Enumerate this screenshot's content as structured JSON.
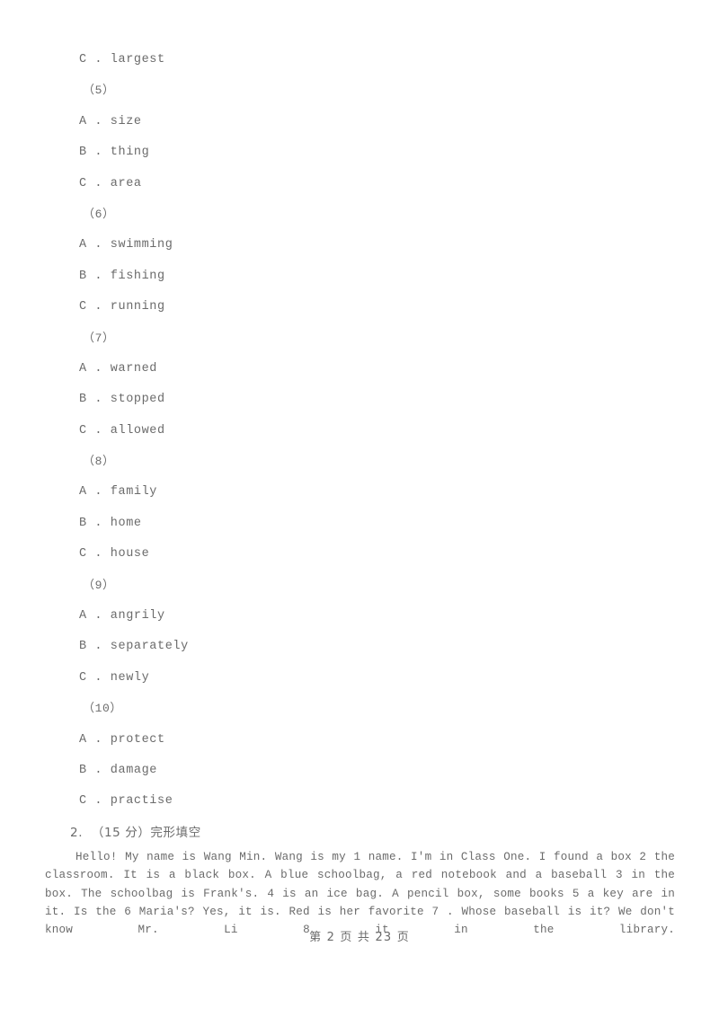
{
  "document": {
    "page_footer": "第 2 页 共 23 页",
    "background_color": "#ffffff",
    "text_color": "#6b6b6b"
  },
  "question_lines": [
    {
      "type": "option",
      "text": "C . largest"
    },
    {
      "type": "qnum",
      "text": "（5）"
    },
    {
      "type": "option",
      "text": "A . size"
    },
    {
      "type": "option",
      "text": "B . thing"
    },
    {
      "type": "option",
      "text": "C . area"
    },
    {
      "type": "qnum",
      "text": "（6）"
    },
    {
      "type": "option",
      "text": "A . swimming"
    },
    {
      "type": "option",
      "text": "B . fishing"
    },
    {
      "type": "option",
      "text": "C . running"
    },
    {
      "type": "qnum",
      "text": "（7）"
    },
    {
      "type": "option",
      "text": "A . warned"
    },
    {
      "type": "option",
      "text": "B . stopped"
    },
    {
      "type": "option",
      "text": "C . allowed"
    },
    {
      "type": "qnum",
      "text": "（8）"
    },
    {
      "type": "option",
      "text": "A . family"
    },
    {
      "type": "option",
      "text": "B . home"
    },
    {
      "type": "option",
      "text": "C . house"
    },
    {
      "type": "qnum",
      "text": "（9）"
    },
    {
      "type": "option",
      "text": "A . angrily"
    },
    {
      "type": "option",
      "text": "B . separately"
    },
    {
      "type": "option",
      "text": "C . newly"
    },
    {
      "type": "qnum",
      "text": "（10）"
    },
    {
      "type": "option",
      "text": "A . protect"
    },
    {
      "type": "option",
      "text": "B . damage"
    },
    {
      "type": "option",
      "text": "C . practise"
    }
  ],
  "section": {
    "number": "2.",
    "score": "（15 分）",
    "title": "完形填空",
    "full_heading": "2.  （15 分）完形填空"
  },
  "passage": {
    "text": "Hello! My name is Wang Min. Wang is my 1 name. I'm in Class One. I found a box 2 the classroom. It is a black box. A blue schoolbag, a red notebook and a baseball 3 in the box. The schoolbag is Frank's. 4 is an ice bag. A pencil box, some books 5 a key are in it. Is the 6 Maria's? Yes, it is. Red is her favorite 7 . Whose baseball is it? We don't know Mr. Li 8 it in the library."
  }
}
